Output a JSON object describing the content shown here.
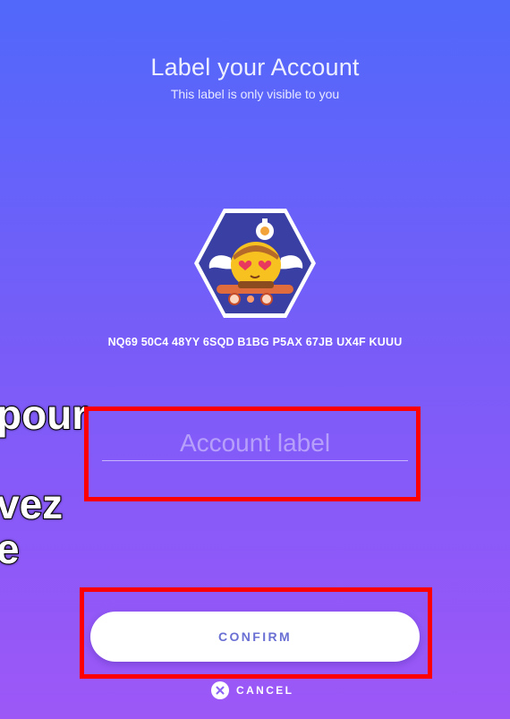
{
  "header": {
    "title": "Label your Account",
    "subtitle": "This label is only visible to you"
  },
  "account": {
    "avatar_icon": "robot-identicon-icon",
    "address": "NQ69 50C4 48YY 6SQD B1BG P5AX 67JB UX4F KUUU"
  },
  "form": {
    "label_input": {
      "value": "",
      "placeholder": "Account label"
    },
    "confirm_label": "CONFIRM",
    "cancel_label": "CANCEL",
    "cancel_icon": "close-icon"
  },
  "overlay": {
    "fragment_1": "pour",
    "fragment_2": "vez",
    "fragment_3": "e"
  },
  "colors": {
    "background_top": "#5168fb",
    "background_bottom": "#9d57f7",
    "highlight": "#ff0000",
    "button_text": "#6a6fd3"
  }
}
